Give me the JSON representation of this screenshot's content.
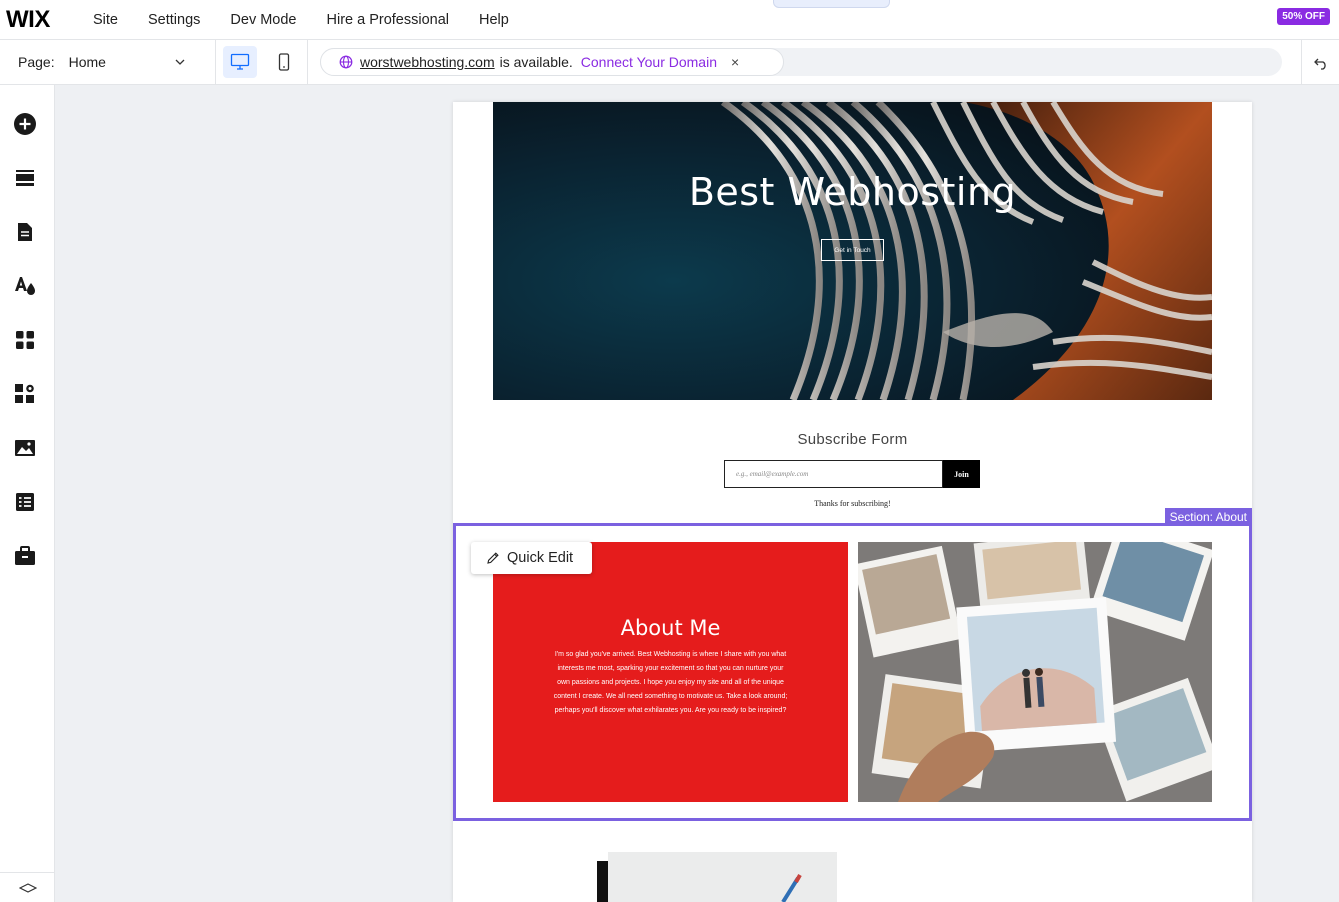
{
  "brand": {
    "logo": "WIX",
    "promo": "50% OFF"
  },
  "top_menu": [
    "Site",
    "Settings",
    "Dev Mode",
    "Hire a Professional",
    "Help"
  ],
  "page_selector": {
    "label": "Page:",
    "value": "Home"
  },
  "domain_bar": {
    "domain": "worstwebhosting.com",
    "status": "is available.",
    "connect": "Connect Your Domain",
    "close": "×"
  },
  "sidebar": {
    "icons": [
      "add-icon",
      "sections-icon",
      "pages-icon",
      "site-design-icon",
      "apps-icon",
      "business-tools-icon",
      "media-icon",
      "cms-icon",
      "portfolio-icon"
    ],
    "bottom": "layers-icon"
  },
  "hero": {
    "title": "Best Webhosting",
    "button": "Get in Touch"
  },
  "subscribe": {
    "title": "Subscribe Form",
    "placeholder": "e.g., email@example.com",
    "join": "Join",
    "thanks": "Thanks for subscribing!"
  },
  "about": {
    "section_label": "Section: About",
    "quick_edit": "Quick Edit",
    "title": "About Me",
    "text": "I'm so glad you've arrived. Best Webhosting is where I share with you what interests me most, sparking your excitement so that you can nurture your own passions and projects. I hope you enjoy my site and all of the unique content I create. We all need something to motivate us. Take a look around; perhaps you'll discover what exhilarates you. Are you ready to be inspired?"
  },
  "colors": {
    "accent": "#8a2be2",
    "selection": "#7b61e0",
    "about_bg": "#e51c1c"
  }
}
